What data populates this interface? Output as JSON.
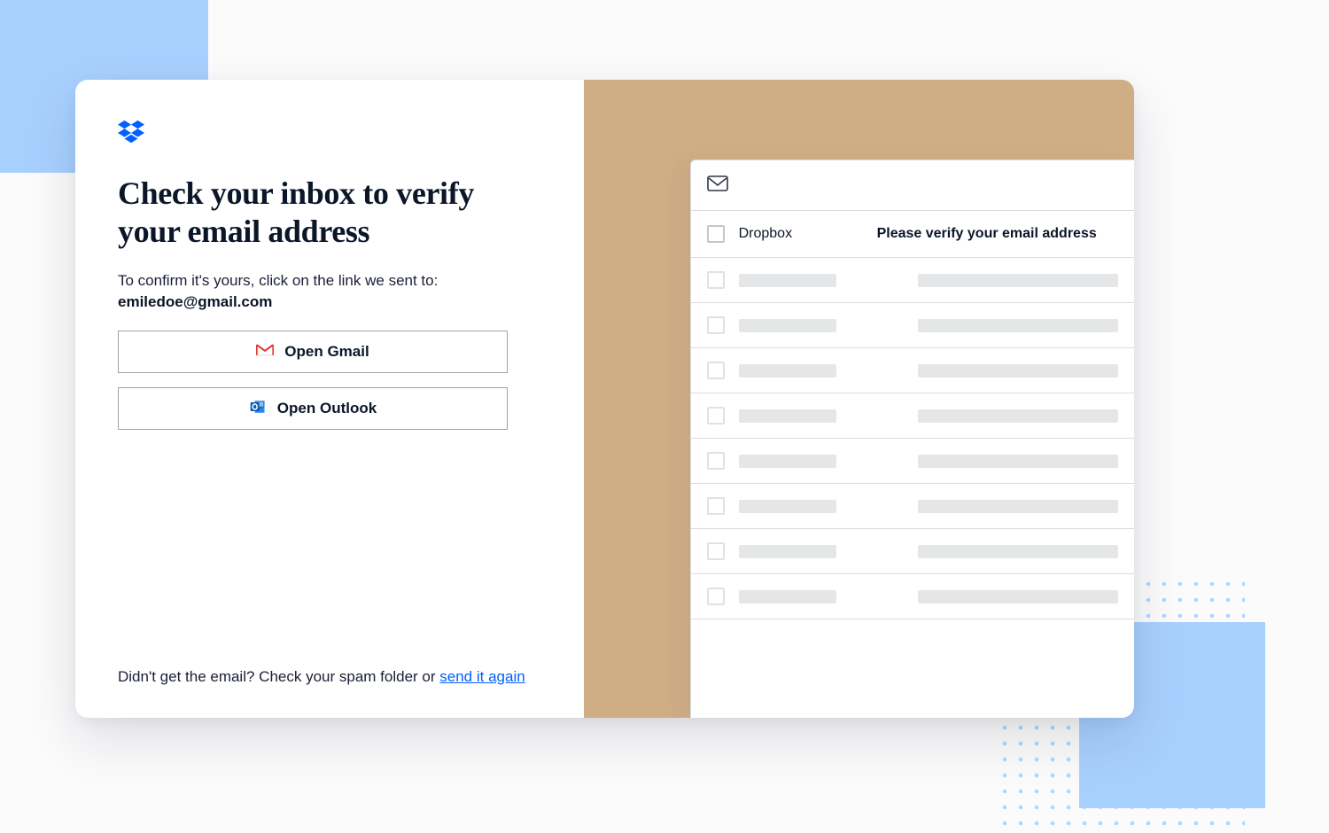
{
  "heading": "Check your inbox to verify your email address",
  "lead": "To confirm it's yours, click on the link we sent to:",
  "email": "emiledoe@gmail.com",
  "buttons": {
    "gmail": "Open Gmail",
    "outlook": "Open Outlook"
  },
  "hint_prefix": "Didn't get the email? Check your spam folder or ",
  "hint_link": "send it again",
  "inbox": {
    "sender": "Dropbox",
    "subject": "Please verify your email address"
  },
  "colors": {
    "accent": "#0061fe",
    "decor_blue": "#a8d0ff",
    "decor_tan": "#cfae86"
  }
}
